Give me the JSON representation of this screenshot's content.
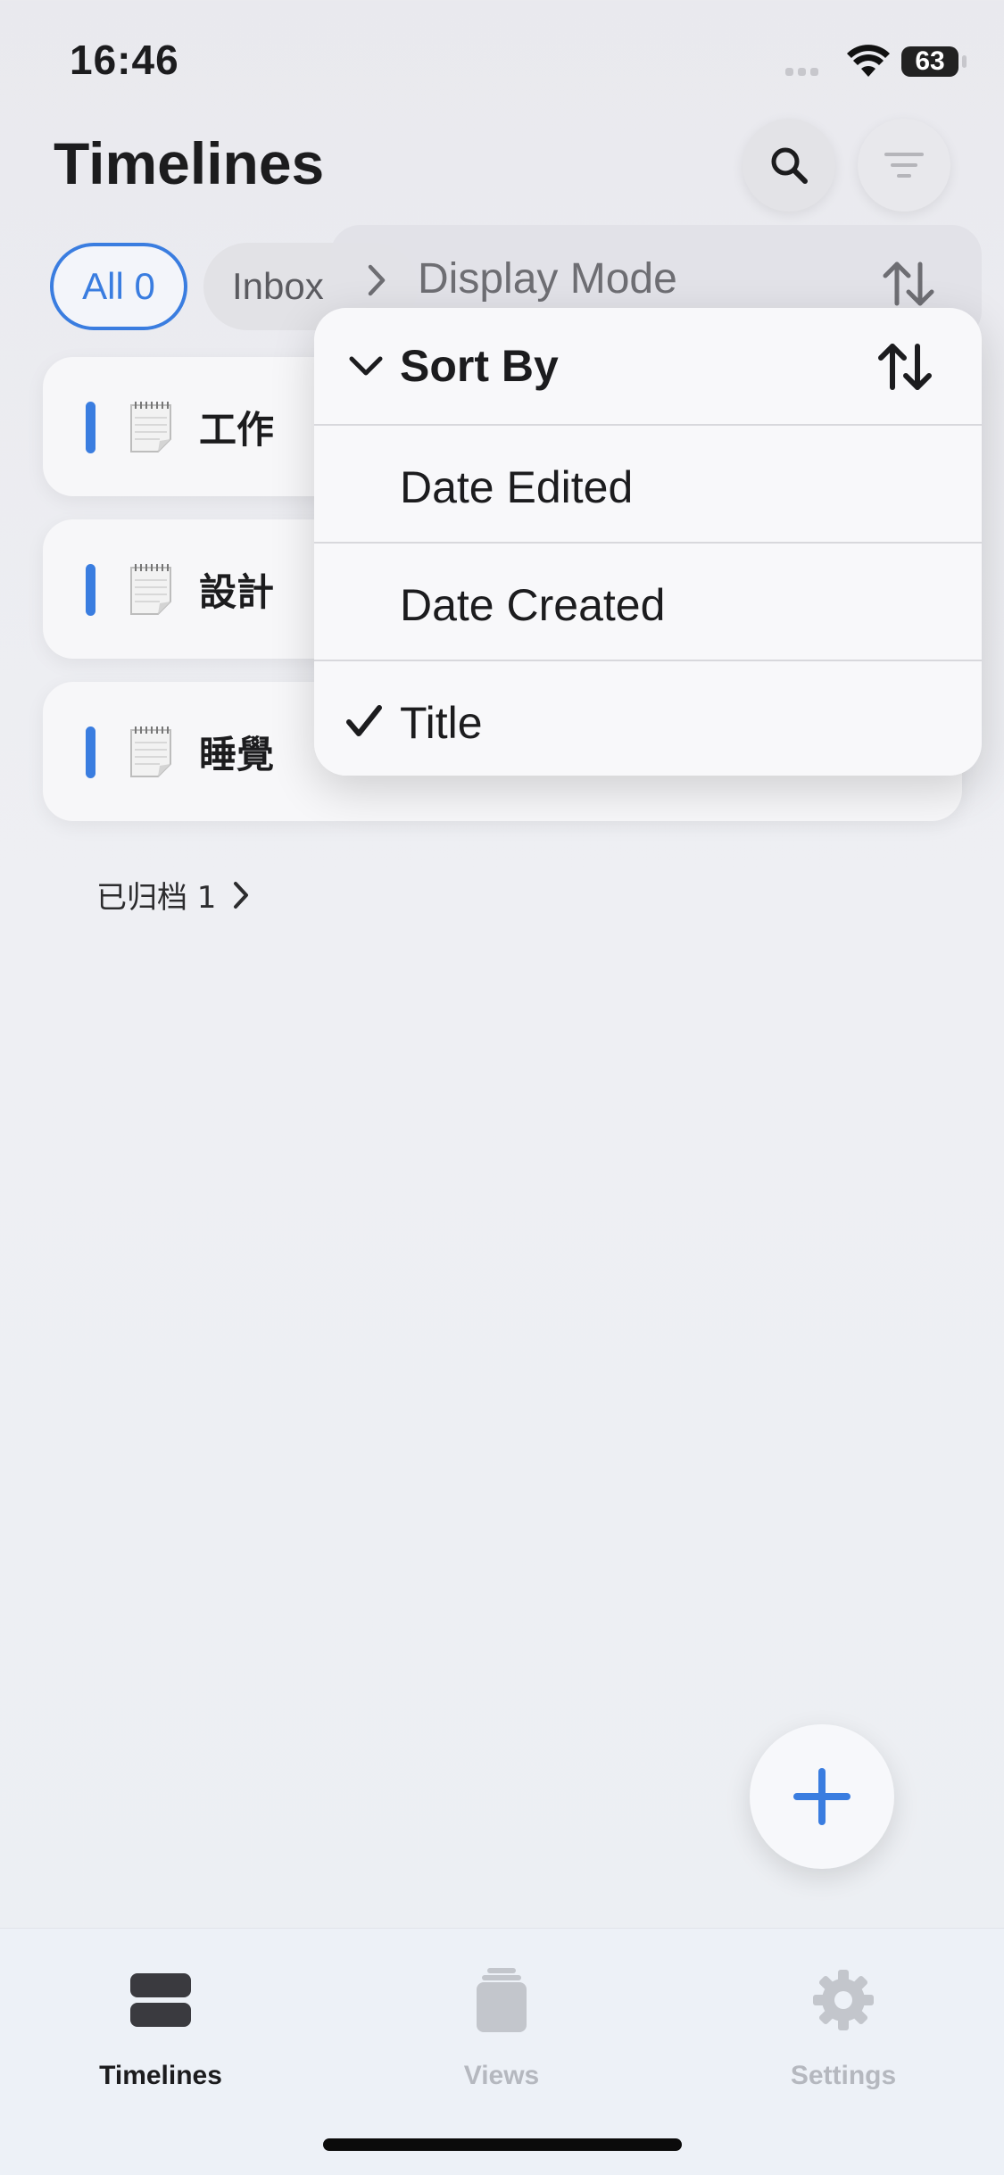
{
  "status": {
    "time": "16:46",
    "battery": "63"
  },
  "header": {
    "title": "Timelines"
  },
  "filters": [
    {
      "label": "All 0",
      "selected": true
    },
    {
      "label": "Inbox",
      "selected": false
    }
  ],
  "timelines": [
    {
      "name": "工作",
      "color": "#3a7de0",
      "icon": "notepad-icon"
    },
    {
      "name": "設計",
      "color": "#3a7de0",
      "icon": "notepad-icon"
    },
    {
      "name": "睡覺",
      "color": "#3a7de0",
      "icon": "notepad-icon"
    }
  ],
  "archived": {
    "label": "已归档 1"
  },
  "menu": {
    "parent_label": "Display Mode",
    "section_label": "Sort By",
    "options": [
      {
        "label": "Date Edited",
        "checked": false
      },
      {
        "label": "Date Created",
        "checked": false
      },
      {
        "label": "Title",
        "checked": true
      }
    ]
  },
  "tabs": [
    {
      "label": "Timelines",
      "active": true,
      "icon": "stack-icon"
    },
    {
      "label": "Views",
      "active": false,
      "icon": "archive-box-icon"
    },
    {
      "label": "Settings",
      "active": false,
      "icon": "gear-icon"
    }
  ],
  "colors": {
    "accent": "#3a7de0",
    "inactive_tab": "#b5b8bf"
  }
}
